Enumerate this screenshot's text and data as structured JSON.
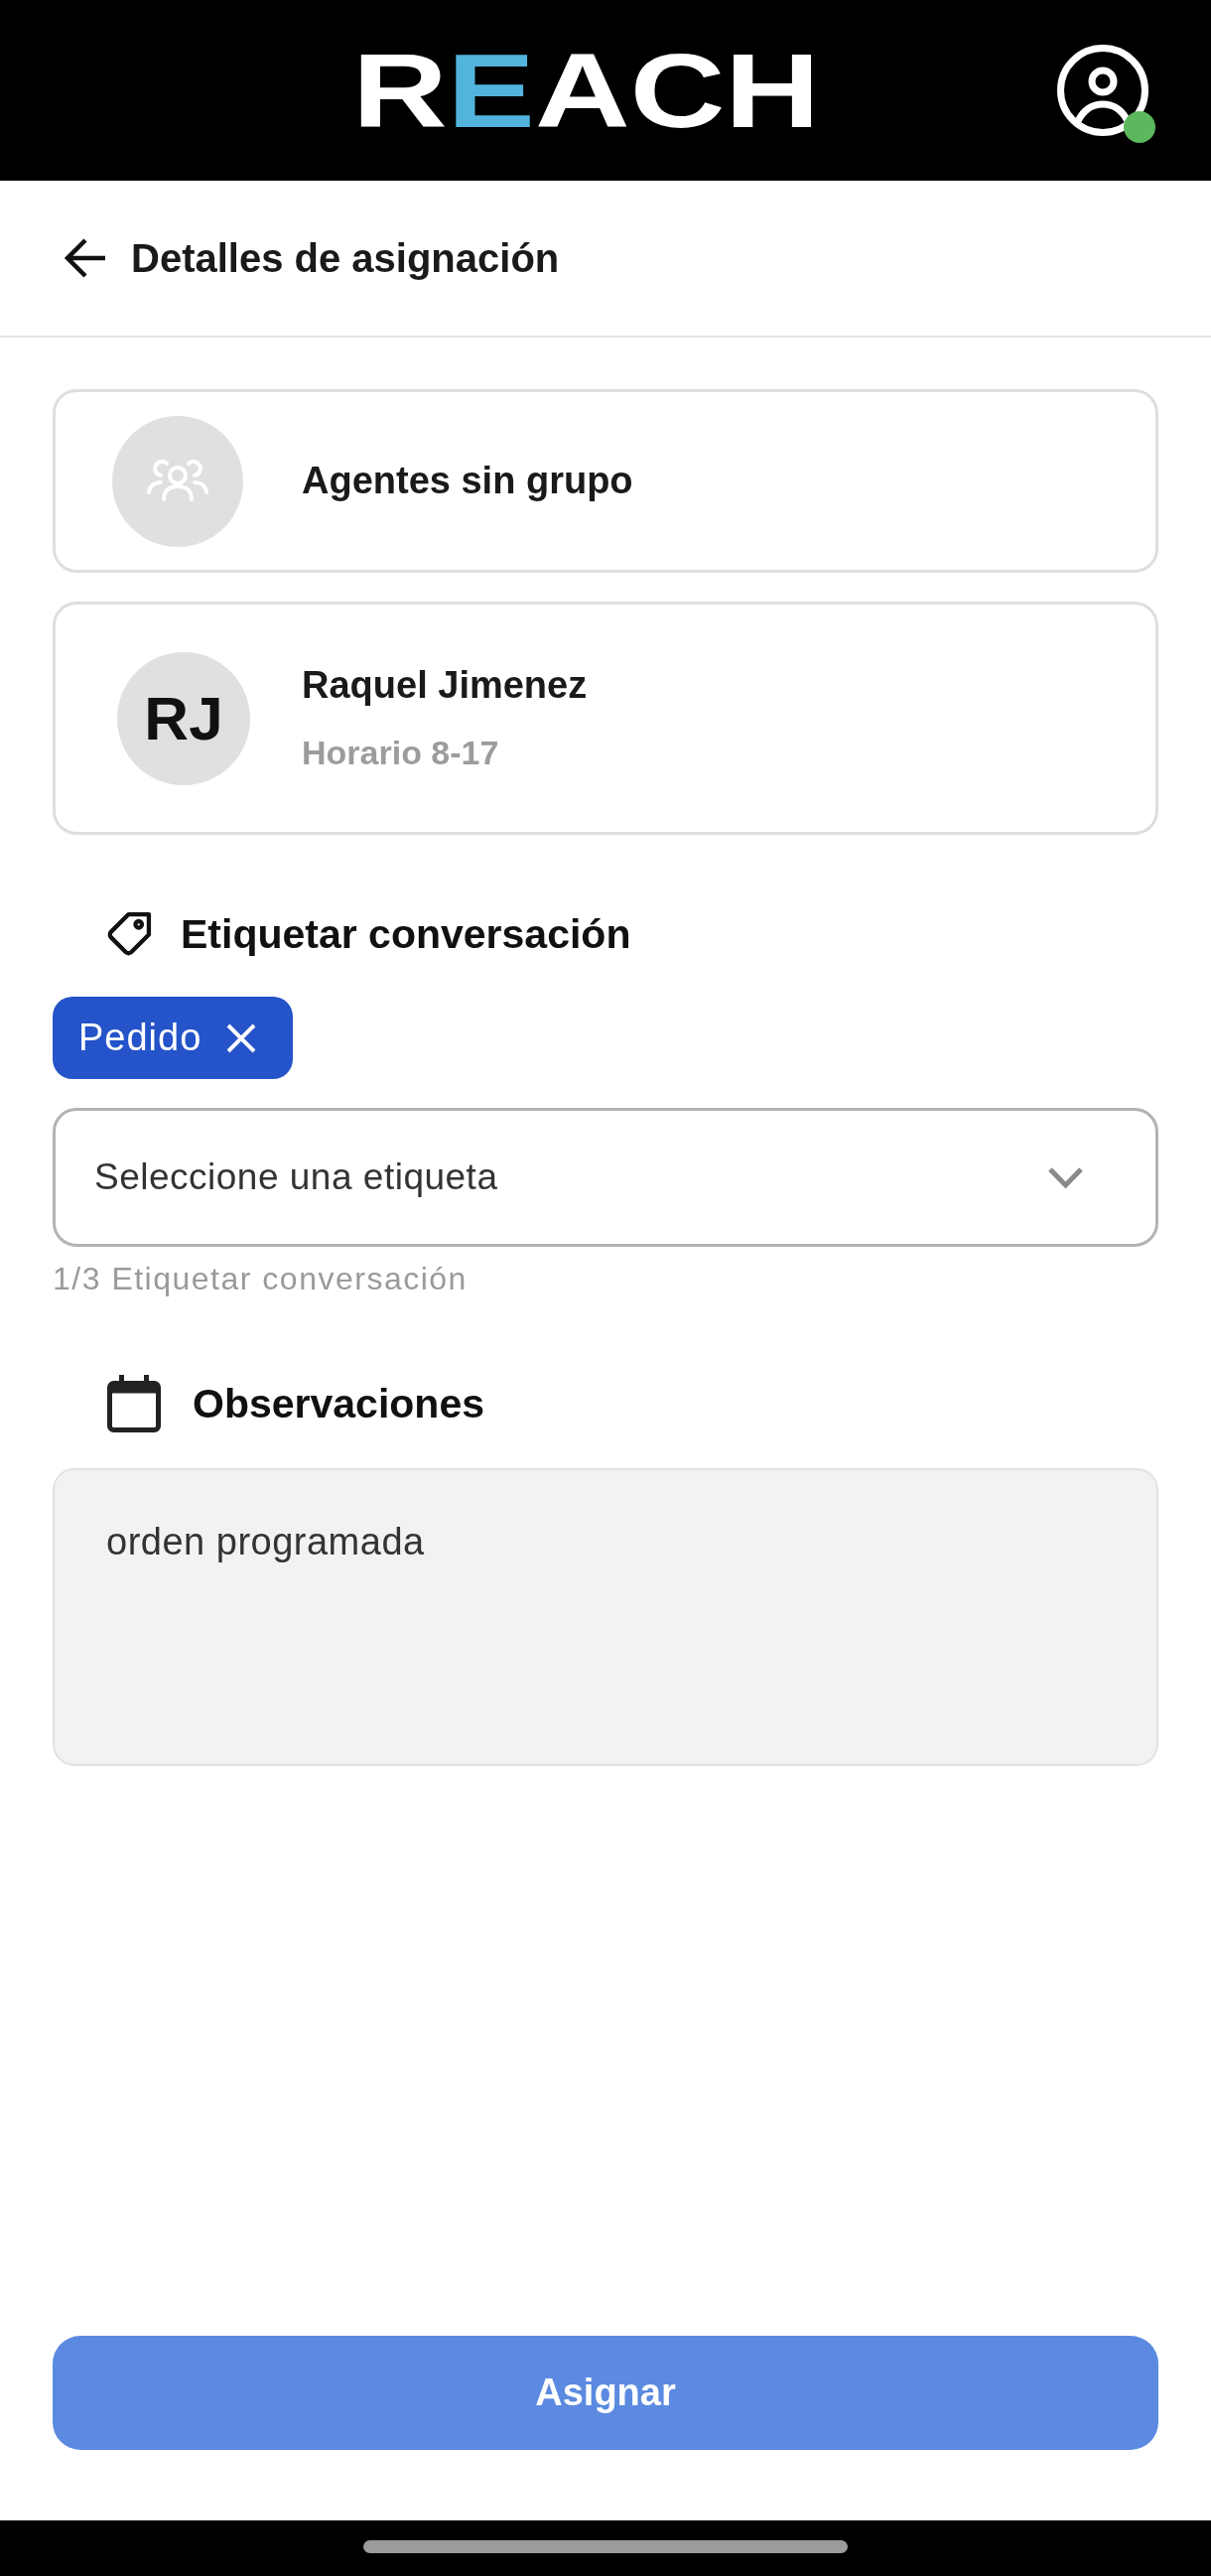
{
  "header": {
    "logo": [
      {
        "text": "R",
        "color": "#ffffff"
      },
      {
        "text": "E",
        "color": "#52b4dc"
      },
      {
        "text": "ACH",
        "color": "#ffffff"
      }
    ],
    "profile": {
      "online": true
    }
  },
  "title_bar": {
    "title": "Detalles de asignación"
  },
  "assignment_cards": [
    {
      "kind": "group",
      "title": "Agentes sin grupo"
    },
    {
      "kind": "agent",
      "initials": "RJ",
      "name": "Raquel Jimenez",
      "subtitle": "Horario 8-17"
    }
  ],
  "tags_section": {
    "title": "Etiquetar conversación",
    "tags": [
      {
        "label": "Pedido"
      }
    ],
    "select": {
      "placeholder": "Seleccione una etiqueta"
    },
    "helper": "1/3 Etiquetar conversación"
  },
  "notes_section": {
    "title": "Observaciones",
    "value": "orden programada"
  },
  "assign_button": {
    "label": "Asignar"
  }
}
